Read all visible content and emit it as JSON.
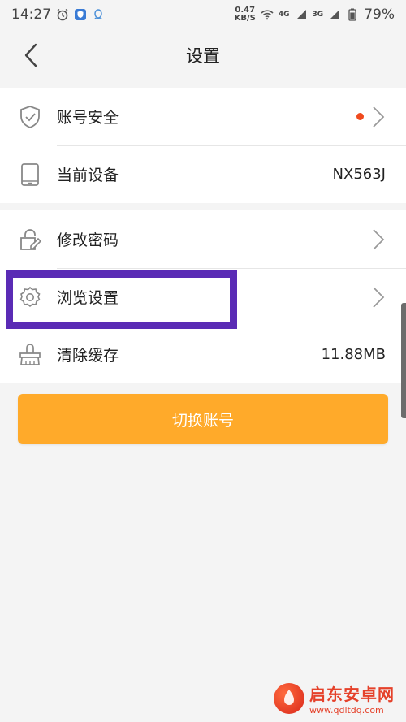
{
  "status_bar": {
    "time": "14:27",
    "speed_value": "0.47",
    "speed_unit": "KB/S",
    "net1": "4G",
    "net2": "3G",
    "battery": "79%"
  },
  "header": {
    "title": "设置",
    "back_icon": "chevron-left-icon"
  },
  "groups": [
    {
      "rows": [
        {
          "icon": "shield-check-icon",
          "label": "账号安全",
          "value": "",
          "has_dot": true,
          "has_chevron": true
        },
        {
          "icon": "tablet-icon",
          "label": "当前设备",
          "value": "NX563J",
          "has_dot": false,
          "has_chevron": false
        }
      ]
    },
    {
      "rows": [
        {
          "icon": "lock-edit-icon",
          "label": "修改密码",
          "value": "",
          "has_chevron": true
        },
        {
          "icon": "gear-icon",
          "label": "浏览设置",
          "value": "",
          "has_chevron": true
        },
        {
          "icon": "broom-icon",
          "label": "清除缓存",
          "value": "11.88MB",
          "has_chevron": false
        }
      ]
    }
  ],
  "switch_account_label": "切换账号",
  "colors": {
    "accent": "#ffaa2a",
    "highlight": "#5a2bb5",
    "dot": "#f04a1e"
  },
  "watermark": {
    "title": "启东安卓网",
    "url": "www.qdltdq.com"
  }
}
